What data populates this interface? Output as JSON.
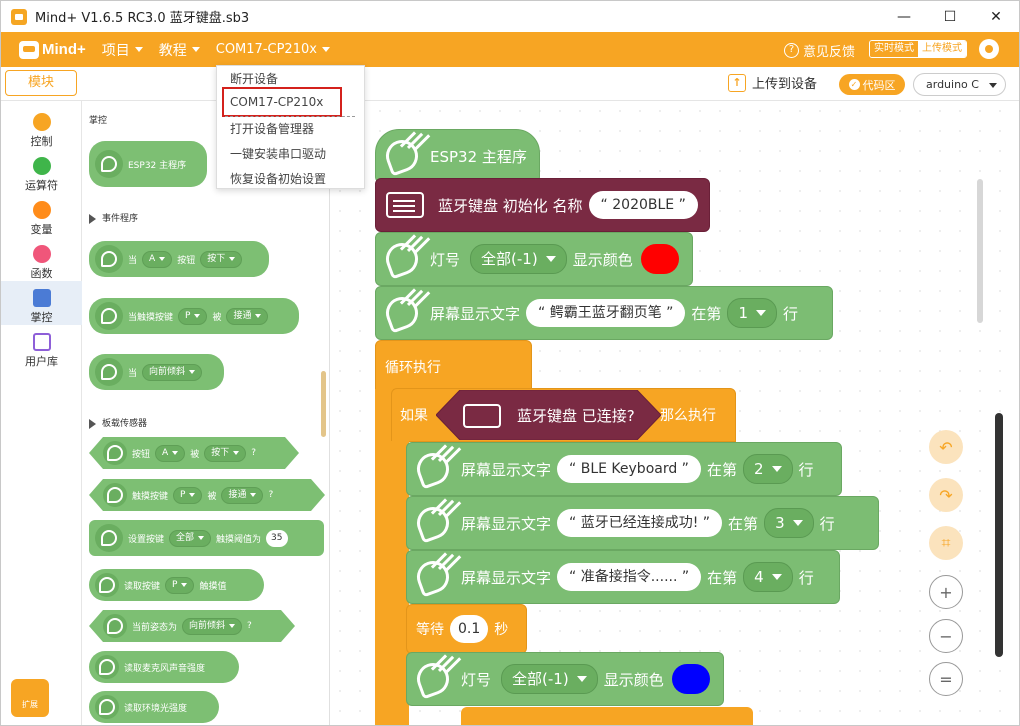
{
  "window": {
    "title": "Mind+ V1.6.5 RC3.0  蓝牙键盘.sb3",
    "minimize": "—",
    "maximize": "☐",
    "close": "✕"
  },
  "menu": {
    "logo": "Mind+",
    "project": "项目",
    "tutorial": "教程",
    "port": "COM17-CP210x",
    "feedback": "意见反馈",
    "mode_live": "实时模式",
    "mode_upload": "上传模式"
  },
  "toolbar": {
    "modules": "模块",
    "upload": "上传到设备",
    "code": "代码区",
    "board": "arduino C"
  },
  "categories": [
    {
      "label": "控制",
      "color": "#f7a523"
    },
    {
      "label": "运算符",
      "color": "#3fb54a"
    },
    {
      "label": "变量",
      "color": "#ff8c1a"
    },
    {
      "label": "函数",
      "color": "#f0567a"
    },
    {
      "label": "掌控",
      "color": "#4b7bd5"
    },
    {
      "label": "用户库",
      "color": "#8e5fd8"
    }
  ],
  "palette": {
    "section_main": "掌控",
    "main_block": "ESP32 主程序",
    "section_events": "事件程序",
    "ev1": {
      "a": "当",
      "b": "A",
      "c": "按钮",
      "d": "按下"
    },
    "ev2": {
      "a": "当触摸按键",
      "b": "P",
      "c": "被",
      "d": "接通"
    },
    "ev3": {
      "a": "当",
      "b": "向前倾斜"
    },
    "section_sensors": "板载传感器",
    "s1": {
      "a": "按钮",
      "b": "A",
      "c": "被",
      "d": "按下",
      "q": "?"
    },
    "s2": {
      "a": "触摸按键",
      "b": "P",
      "c": "被",
      "d": "接通",
      "q": "?"
    },
    "s3": {
      "a": "设置按键",
      "b": "全部",
      "c": "触摸阈值为",
      "d": "35"
    },
    "s4": {
      "a": "读取按键",
      "b": "P",
      "c": "触摸值"
    },
    "s5": {
      "a": "当前姿态为",
      "b": "向前倾斜",
      "q": "?"
    },
    "s6": "读取麦克风声音强度",
    "s7": "读取环境光强度",
    "ext": "扩展"
  },
  "dropdown": {
    "items": [
      "断开设备",
      "COM17-CP210x",
      "打开设备管理器",
      "一键安装串口驱动",
      "恢复设备初始设置"
    ]
  },
  "workspace": {
    "main": "ESP32 主程序",
    "bt_init": {
      "a": "蓝牙键盘 初始化 名称",
      "b": "2020BLE"
    },
    "led1": {
      "a": "灯号",
      "b": "全部(-1)",
      "c": "显示颜色",
      "color": "#ff0000"
    },
    "screen1": {
      "a": "屏幕显示文字",
      "b": "鳄霸王蓝牙翻页笔",
      "c": "在第",
      "d": "1",
      "e": "行"
    },
    "loop": "循环执行",
    "if": {
      "a": "如果",
      "b": "蓝牙键盘 已连接?",
      "c": "那么执行"
    },
    "screen2": {
      "a": "屏幕显示文字",
      "b": "BLE Keyboard",
      "c": "在第",
      "d": "2",
      "e": "行"
    },
    "screen3": {
      "a": "屏幕显示文字",
      "b": "蓝牙已经连接成功!",
      "c": "在第",
      "d": "3",
      "e": "行"
    },
    "screen4": {
      "a": "屏幕显示文字",
      "b": "准备接指令......",
      "c": "在第",
      "d": "4",
      "e": "行"
    },
    "wait": {
      "a": "等待",
      "b": "0.1",
      "c": "秒"
    },
    "led2": {
      "a": "灯号",
      "b": "全部(-1)",
      "c": "显示颜色",
      "color": "#0000ff"
    }
  },
  "controls": {
    "undo": "↶",
    "redo": "↷",
    "crop": "⌗",
    "zoom_in": "+",
    "zoom_out": "−",
    "reset": "="
  }
}
